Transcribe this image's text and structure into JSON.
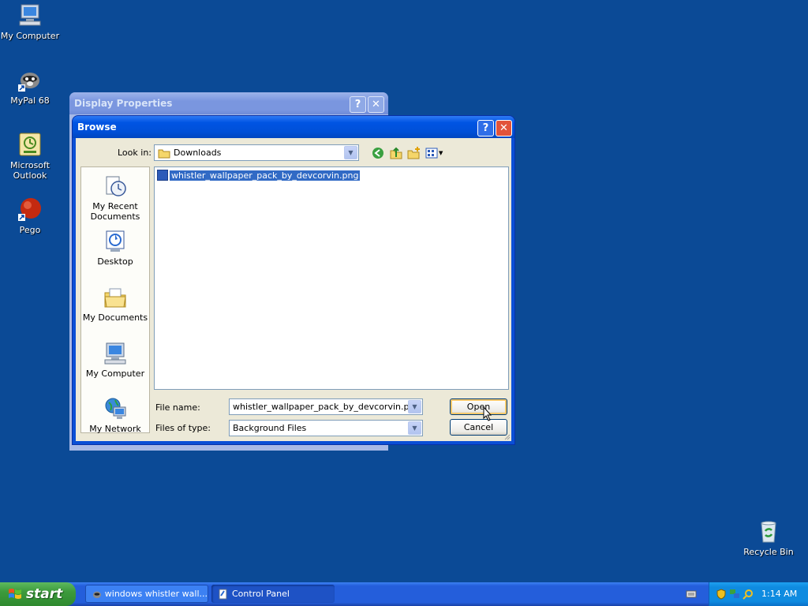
{
  "desktop": {
    "icons": [
      {
        "label": "My Computer",
        "icon": "my-computer-icon"
      },
      {
        "label": "MyPal 68",
        "icon": "mypal-icon"
      },
      {
        "label": "Microsoft Outlook",
        "icon": "outlook-icon"
      },
      {
        "label": "Pego",
        "icon": "pego-icon"
      },
      {
        "label": "Recycle Bin",
        "icon": "recycle-bin-icon"
      }
    ]
  },
  "display_properties": {
    "title": "Display Properties",
    "help": "?",
    "close": "✕"
  },
  "browse": {
    "title": "Browse",
    "help": "?",
    "close": "✕",
    "look_in_label": "Look in:",
    "look_in_value": "Downloads",
    "places": [
      {
        "label": "My Recent Documents",
        "icon": "recent-documents-icon"
      },
      {
        "label": "Desktop",
        "icon": "desktop-icon"
      },
      {
        "label": "My Documents",
        "icon": "my-documents-icon"
      },
      {
        "label": "My Computer",
        "icon": "my-computer-icon"
      },
      {
        "label": "My Network",
        "icon": "my-network-icon"
      }
    ],
    "files": [
      {
        "name": "whistler_wallpaper_pack_by_devcorvin.png",
        "selected": true
      }
    ],
    "file_name_label": "File name:",
    "file_name_value": "whistler_wallpaper_pack_by_devcorvin.png",
    "files_of_type_label": "Files of type:",
    "files_of_type_value": "Background Files",
    "open_label": "Open",
    "cancel_label": "Cancel"
  },
  "taskbar": {
    "start_label": "start",
    "tasks": [
      {
        "label": "windows whistler wall..."
      },
      {
        "label": "Control Panel"
      }
    ],
    "clock": "1:14 AM"
  },
  "colors": {
    "desktop": "#0b4a96",
    "title_active": "#0054e3",
    "selection": "#316ac5"
  }
}
